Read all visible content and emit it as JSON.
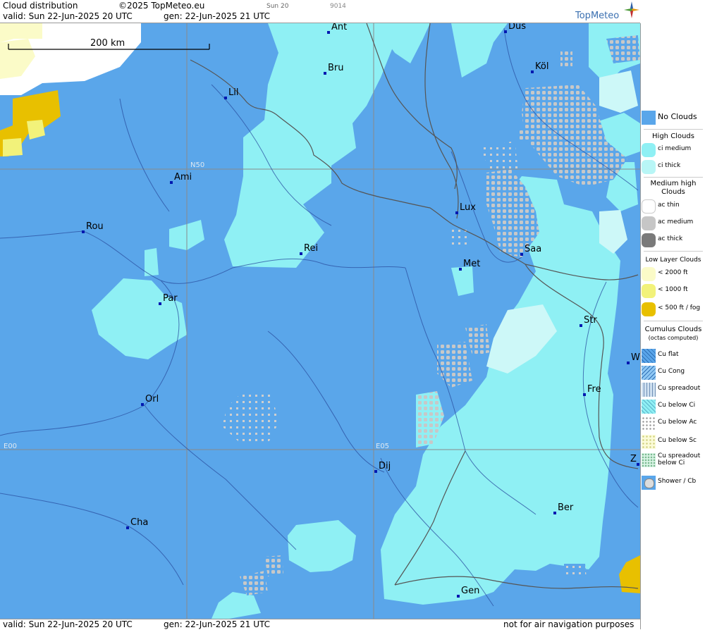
{
  "header": {
    "title": "Cloud distribution",
    "copyright": "©2025 TopMeteo.eu",
    "run_small": "Sun 20",
    "code_small": "9014",
    "valid": "valid:  Sun  22-Jun-2025  20 UTC",
    "gen": "gen: 22-Jun-2025 21 UTC",
    "logo": "TopMeteo"
  },
  "footer": {
    "valid": "valid:  Sun  22-Jun-2025  20 UTC",
    "gen": "gen: 22-Jun-2025 21 UTC",
    "disclaimer": "not for air navigation purposes"
  },
  "map": {
    "scale_label": "200 km",
    "grid_labels": {
      "lat": "N50",
      "lon_west": "E00",
      "lon_east": "E05"
    },
    "cities": [
      {
        "name": "Ant"
      },
      {
        "name": "Düs"
      },
      {
        "name": "Bru"
      },
      {
        "name": "Köl"
      },
      {
        "name": "Lil"
      },
      {
        "name": "Ami"
      },
      {
        "name": "Rou"
      },
      {
        "name": "Lux"
      },
      {
        "name": "Rei"
      },
      {
        "name": "Saa"
      },
      {
        "name": "Met"
      },
      {
        "name": "Par"
      },
      {
        "name": "Str"
      },
      {
        "name": "W"
      },
      {
        "name": "Fre"
      },
      {
        "name": "Orl"
      },
      {
        "name": "Dij"
      },
      {
        "name": "Z"
      },
      {
        "name": "Ber"
      },
      {
        "name": "Cha"
      },
      {
        "name": "Gen"
      }
    ]
  },
  "legend": {
    "no_clouds": "No Clouds",
    "high_head": "High Clouds",
    "ci_medium": "ci medium",
    "ci_thick": "ci thick",
    "medium_head_1": "Medium high",
    "medium_head_2": "Clouds",
    "ac_thin": "ac thin",
    "ac_medium": "ac medium",
    "ac_thick": "ac thick",
    "low_head": "Low Layer Clouds",
    "low_2000": "< 2000 ft",
    "low_1000": "< 1000 ft",
    "low_500": "< 500 ft / fog",
    "cu_head_1": "Cumulus Clouds",
    "cu_head_2": "(octas computed)",
    "cu_flat": "Cu flat",
    "cu_cong": "Cu Cong",
    "cu_spread": "Cu spreadout",
    "cu_below_ci": "Cu below Ci",
    "cu_below_ac": "Cu below Ac",
    "cu_below_sc": "Cu below Sc",
    "cu_spread_ci_1": "Cu spreadout",
    "cu_spread_ci_2": "below Ci",
    "shower": "Shower / Cb"
  },
  "colors": {
    "no_clouds": "#5aa6ea",
    "ci_medium": "#8ff0f4",
    "ci_thick": "#b8f6f6",
    "ac_thin": "#ffffff",
    "ac_medium": "#c6c6c6",
    "ac_thick": "#7a7a7a",
    "low_2000": "#fbfbc8",
    "low_1000": "#f2f27a",
    "low_500": "#e8c000",
    "border": "#555555",
    "river": "#2a4fa0"
  }
}
